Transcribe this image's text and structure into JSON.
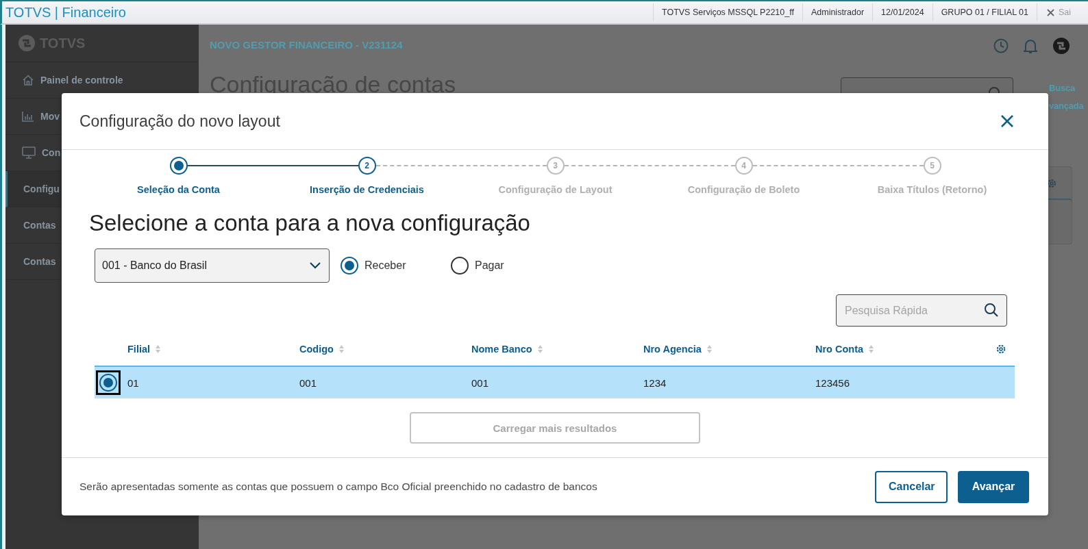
{
  "title_bar": {
    "app_title": "TOTVS | Financeiro",
    "items": [
      "TOTVS Serviços MSSQL P2210_ff",
      "Administrador",
      "12/01/2024",
      "GRUPO 01 / FILIAL 01"
    ],
    "exit": "Sai"
  },
  "sidebar": {
    "logo": "TOTVS",
    "items": [
      {
        "label": "Painel de controle",
        "kind": "home",
        "selected": false
      },
      {
        "label": "Mov",
        "kind": "chart",
        "selected": false
      },
      {
        "label": "Con",
        "kind": "monitor",
        "selected": false
      },
      {
        "label": "Configu",
        "kind": "sub",
        "selected": true
      },
      {
        "label": "Contas",
        "kind": "sub",
        "selected": false
      },
      {
        "label": "Contas",
        "kind": "sub",
        "selected": false
      }
    ]
  },
  "header": {
    "product": "NOVO GESTOR FINANCEIRO - V231124"
  },
  "page": {
    "title": "Configuração de contas",
    "advanced_search": [
      "Busca",
      "vançada"
    ]
  },
  "modal": {
    "title": "Configuração do novo layout",
    "steps": [
      {
        "label": "Seleção da Conta",
        "selected": true,
        "enabled": true
      },
      {
        "number": "2",
        "label": "Inserção de Credenciais",
        "selected": false,
        "enabled": true
      },
      {
        "number": "3",
        "label": "Configuração de Layout",
        "selected": false,
        "enabled": false
      },
      {
        "number": "4",
        "label": "Configuração de Boleto",
        "selected": false,
        "enabled": false
      },
      {
        "number": "5",
        "label": "Baixa Títulos (Retorno)",
        "selected": false,
        "enabled": false
      }
    ],
    "heading": "Selecione a conta para a nova configuração",
    "bank_select": {
      "value": "001 - Banco do Brasil"
    },
    "type_options": [
      {
        "label": "Receber",
        "selected": true
      },
      {
        "label": "Pagar",
        "selected": false
      }
    ],
    "search": {
      "placeholder": "Pesquisa Rápida"
    },
    "table": {
      "columns": [
        "Filial",
        "Codigo",
        "Nome Banco",
        "Nro Agencia",
        "Nro Conta"
      ],
      "rows": [
        {
          "selected": true,
          "cells": [
            "01",
            "001",
            "001",
            "1234",
            "123456"
          ]
        }
      ]
    },
    "load_more": {
      "label": "Carregar mais resultados",
      "disabled": true
    },
    "footer_note": "Serão apresentadas somente as contas que possuem o campo Bco Oficial preenchido no cadastro de bancos",
    "buttons": [
      {
        "label": "Cancelar",
        "kind": "secondary"
      },
      {
        "label": "Avançar",
        "kind": "primary"
      }
    ]
  }
}
